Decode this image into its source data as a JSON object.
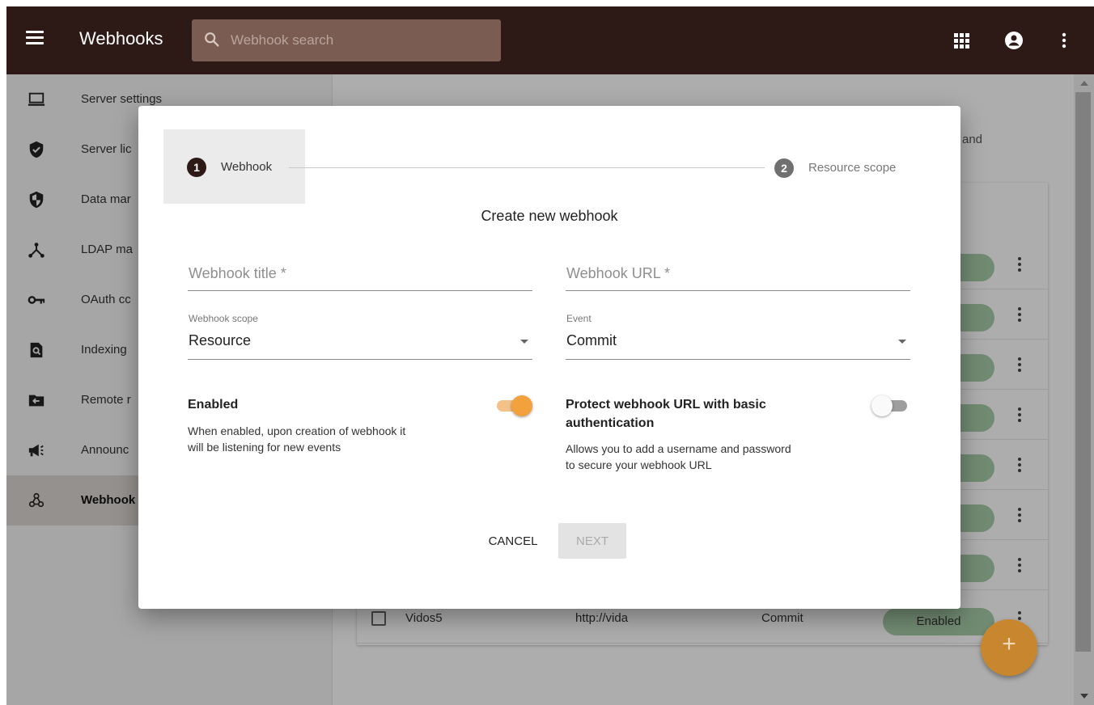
{
  "header": {
    "title": "Webhooks",
    "search_placeholder": "Webhook search",
    "icons": [
      "menu-icon",
      "search-icon",
      "apps-grid-icon",
      "account-circle-icon",
      "more-vert-icon"
    ]
  },
  "sidebar": {
    "items": [
      {
        "label": "Server settings",
        "icon": "laptop-icon"
      },
      {
        "label": "Server lic",
        "icon": "shield-check-icon"
      },
      {
        "label": "Data mar",
        "icon": "shield-half-icon"
      },
      {
        "label": "LDAP ma",
        "icon": "hierarchy-icon"
      },
      {
        "label": "OAuth cc",
        "icon": "key-icon"
      },
      {
        "label": "Indexing",
        "icon": "search-document-icon"
      },
      {
        "label": "Remote r",
        "icon": "folder-import-icon"
      },
      {
        "label": "Announc",
        "icon": "megaphone-icon"
      },
      {
        "label": "Webhook",
        "icon": "webhook-icon",
        "active": true
      }
    ]
  },
  "background": {
    "partial_text": "and",
    "last_row": {
      "name": "Vidos5",
      "url": "http://vida",
      "event": "Commit",
      "status": "Enabled"
    }
  },
  "dialog": {
    "steps": [
      {
        "number": "1",
        "label": "Webhook",
        "active": true
      },
      {
        "number": "2",
        "label": "Resource scope",
        "active": false
      }
    ],
    "title": "Create new webhook",
    "fields": {
      "title_placeholder": "Webhook title *",
      "url_placeholder": "Webhook URL *",
      "scope_label": "Webhook scope",
      "scope_value": "Resource",
      "event_label": "Event",
      "event_value": "Commit"
    },
    "enabled": {
      "title": "Enabled",
      "desc_line1": "When enabled, upon creation of webhook it",
      "desc_line2": "will be listening for new events",
      "on": true
    },
    "protect": {
      "title_line1": "Protect webhook URL with basic",
      "title_line2": "authentication",
      "desc_line1": "Allows you to add a username and password",
      "desc_line2": "to secure your webhook URL",
      "on": false
    },
    "buttons": {
      "cancel": "CANCEL",
      "next": "NEXT"
    }
  },
  "fab": {
    "label": "+"
  },
  "colors": {
    "topbar": "#2d1a16",
    "search_bg": "#7a5c52",
    "accent": "#f2a13c",
    "status_green": "#a7cda8"
  }
}
